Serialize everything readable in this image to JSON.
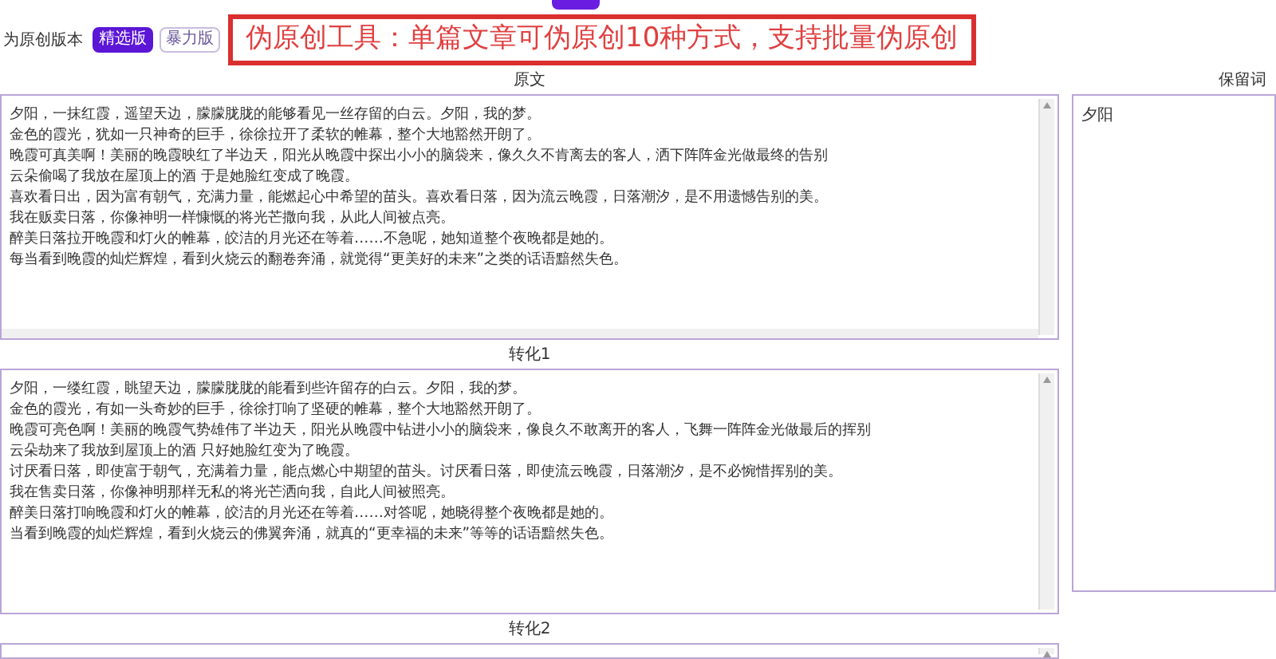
{
  "version_row": {
    "label": "为原创版本",
    "options": [
      {
        "label": "精选版",
        "selected": true
      },
      {
        "label": "暴力版",
        "selected": false
      }
    ]
  },
  "banner": "伪原创工具：单篇文章可伪原创10种方式，支持批量伪原创",
  "panels": [
    {
      "title": "原文",
      "lines": [
        "夕阳，一抹红霞，遥望天边，朦朦胧胧的能够看见一丝存留的白云。夕阳，我的梦。",
        "金色的霞光，犹如一只神奇的巨手，徐徐拉开了柔软的帷幕，整个大地豁然开朗了。",
        "晚霞可真美啊！美丽的晚霞映红了半边天，阳光从晚霞中探出小小的脑袋来，像久久不肯离去的客人，洒下阵阵金光做最终的告别",
        "云朵偷喝了我放在屋顶上的酒 于是她脸红变成了晚霞。",
        "喜欢看日出，因为富有朝气，充满力量，能燃起心中希望的苗头。喜欢看日落，因为流云晚霞，日落潮汐，是不用遗憾告别的美。",
        "我在贩卖日落，你像神明一样慷慨的将光芒撒向我，从此人间被点亮。",
        "醉美日落拉开晚霞和灯火的帷幕，皎洁的月光还在等着……不急呢，她知道整个夜晚都是她的。",
        "每当看到晚霞的灿烂辉煌，看到火烧云的翻卷奔涌，就觉得“更美好的未来”之类的话语黯然失色。"
      ]
    },
    {
      "title": "转化1",
      "lines": [
        "夕阳，一缕红霞，眺望天边，朦朦胧胧的能看到些许留存的白云。夕阳，我的梦。",
        "金色的霞光，有如一头奇妙的巨手，徐徐打响了坚硬的帷幕，整个大地豁然开朗了。",
        "晚霞可亮色啊！美丽的晚霞气势雄伟了半边天，阳光从晚霞中钻进小小的脑袋来，像良久不敢离开的客人，飞舞一阵阵金光做最后的挥别",
        "云朵劫来了我放到屋顶上的酒 只好她脸红变为了晚霞。",
        "讨厌看日落，即使富于朝气，充满着力量，能点燃心中期望的苗头。讨厌看日落，即使流云晚霞，日落潮汐，是不必惋惜挥别的美。",
        "我在售卖日落，你像神明那样无私的将光芒洒向我，自此人间被照亮。",
        "醉美日落打响晚霞和灯火的帷幕，皎洁的月光还在等着……对答呢，她晓得整个夜晚都是她的。",
        "当看到晚霞的灿烂辉煌，看到火烧云的佛翼奔涌，就真的“更幸福的未来”等等的话语黯然失色。"
      ]
    },
    {
      "title": "转化2"
    }
  ],
  "keywords": {
    "title": "保留词",
    "value": "夕阳"
  }
}
